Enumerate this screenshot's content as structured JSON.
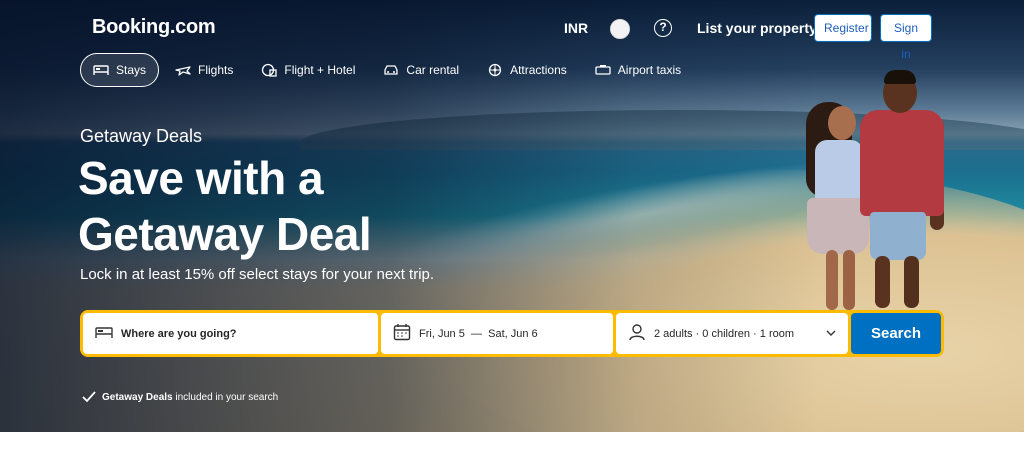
{
  "header": {
    "logo": "Booking.com",
    "currency": "INR",
    "help_symbol": "?",
    "list_property": "List your property",
    "register": "Register",
    "sign_in": "Sign in"
  },
  "nav": {
    "tabs": [
      {
        "label": "Stays",
        "icon": "bed-icon",
        "active": true
      },
      {
        "label": "Flights",
        "icon": "plane-icon",
        "active": false
      },
      {
        "label": "Flight + Hotel",
        "icon": "flight-hotel-icon",
        "active": false
      },
      {
        "label": "Car rental",
        "icon": "car-icon",
        "active": false
      },
      {
        "label": "Attractions",
        "icon": "attractions-icon",
        "active": false
      },
      {
        "label": "Airport taxis",
        "icon": "taxi-icon",
        "active": false
      }
    ]
  },
  "hero": {
    "eyebrow": "Getaway Deals",
    "headline_line1": "Save with a",
    "headline_line2": "Getaway Deal",
    "subline": "Lock in at least 15% off select stays for your next trip."
  },
  "search": {
    "destination_placeholder": "Where are you going?",
    "date_from": "Fri, Jun 5",
    "date_sep": "—",
    "date_to": "Sat, Jun 6",
    "guests": "2 adults · 0 children · 1 room",
    "button": "Search"
  },
  "note": {
    "bold": "Getaway Deals",
    "rest": "included in your search"
  },
  "colors": {
    "search_border": "#febb02",
    "primary_blue": "#0071c2"
  }
}
